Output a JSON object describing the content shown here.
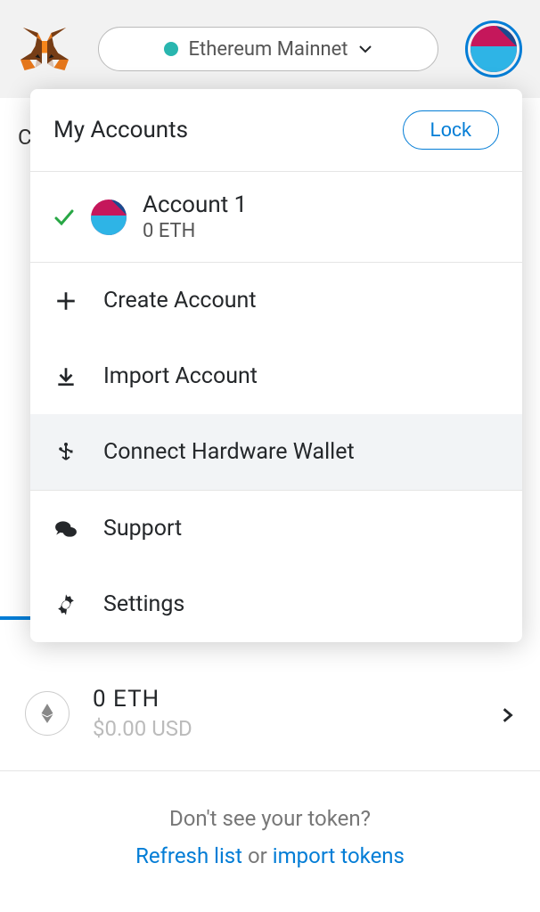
{
  "header": {
    "network_label": "Ethereum Mainnet"
  },
  "dropdown": {
    "title": "My Accounts",
    "lock_label": "Lock",
    "account": {
      "name": "Account 1",
      "balance": "0 ETH"
    },
    "menu": {
      "create": "Create Account",
      "import": "Import Account",
      "hardware": "Connect Hardware Wallet",
      "support": "Support",
      "settings": "Settings"
    }
  },
  "token": {
    "amount": "0 ETH",
    "usd": "$0.00 USD"
  },
  "footer": {
    "prompt": "Don't see your token?",
    "refresh": "Refresh list",
    "or": " or ",
    "import": "import tokens"
  },
  "partial": {
    "search_char": "C"
  }
}
